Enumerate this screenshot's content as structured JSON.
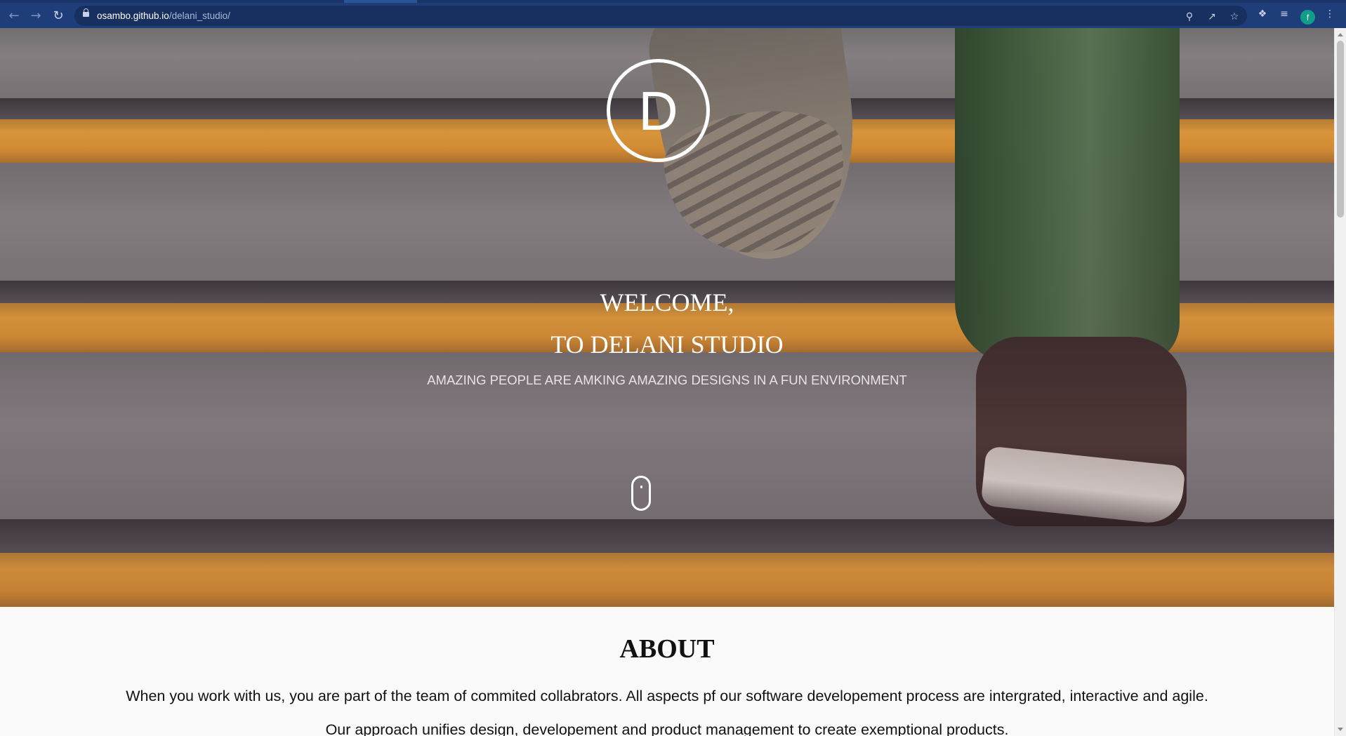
{
  "browser": {
    "url_host": "osambo.github.io",
    "url_path": "/delani_studio/",
    "back_icon": "arrow-left",
    "forward_icon": "arrow-right",
    "reload_icon": "reload",
    "zoom_icon": "magnifier",
    "share_icon": "share",
    "bookmark_icon": "star",
    "extensions_icon": "puzzle",
    "reading_list_icon": "queue",
    "profile_initial": "f",
    "menu_icon": "vertical-dots",
    "chrome_color": "#1f3d78",
    "profile_color": "#0f9d8a"
  },
  "hero": {
    "logo_letter": "D",
    "title_line1": "WELCOME,",
    "title_line2": "TO DELANI STUDIO",
    "subtitle": "AMAZING PEOPLE ARE AMKING AMAZING DESIGNS IN A FUN ENVIRONMENT",
    "scroll_icon": "mouse",
    "stripe_color": "#f0a63a"
  },
  "about": {
    "title": "ABOUT",
    "paragraph_line1": "When you work with us, you are part of the team of commited collabrators. All aspects pf our software developement process are intergrated, interactive and agile.",
    "paragraph_line2": "Our approach unifies design, developement and product management to create exemptional products."
  }
}
